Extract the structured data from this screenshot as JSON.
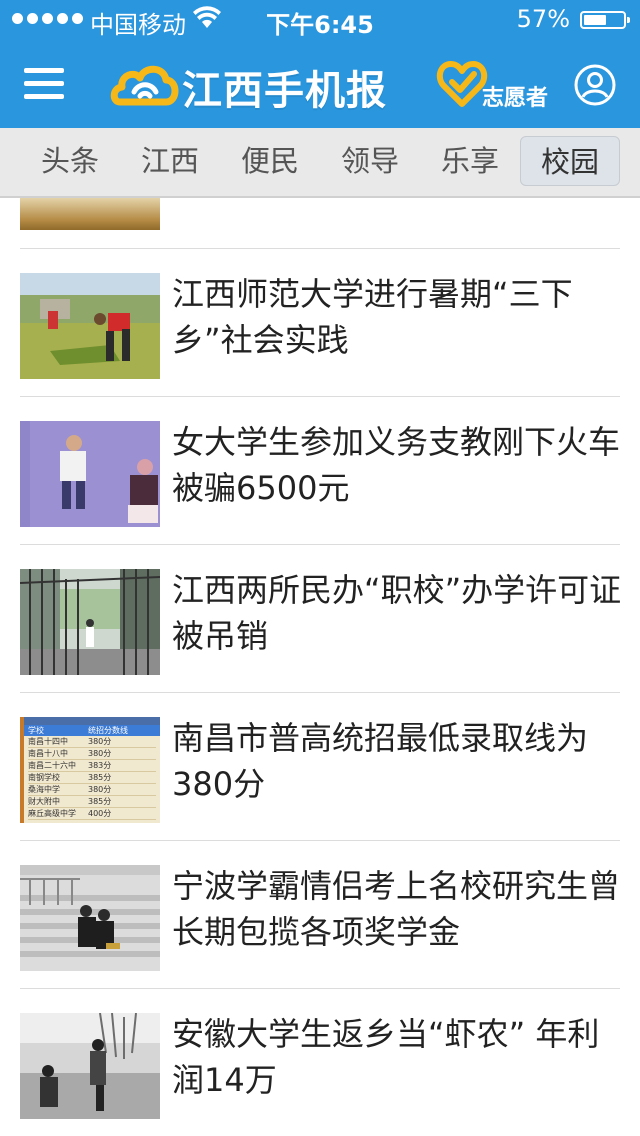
{
  "status_bar": {
    "carrier": "中国移动",
    "time": "下午6:45",
    "battery_text": "57%",
    "battery_level": 0.57
  },
  "header": {
    "app_title": "江西手机报",
    "volunteer_label": "志愿者",
    "icons": [
      "menu-icon",
      "logo-icon",
      "volunteer-heart-icon",
      "user-icon"
    ]
  },
  "tabs": [
    {
      "label": "头条"
    },
    {
      "label": "江西"
    },
    {
      "label": "便民"
    },
    {
      "label": "领导"
    },
    {
      "label": "乐享"
    },
    {
      "label": "校园",
      "active": true
    }
  ],
  "news": [
    {
      "title": "江西师范大学进行暑期“三下乡”社会实践"
    },
    {
      "title": "女大学生参加义务支教刚下火车被骗6500元"
    },
    {
      "title": "江西两所民办“职校”办学许可证被吊销"
    },
    {
      "title": "南昌市普高统招最低录取线为380分"
    },
    {
      "title": "宁波学霸情侣考上名校研究生曾长期包揽各项奖学金"
    },
    {
      "title": "安徽大学生返乡当“虾农” 年利润14万"
    }
  ],
  "score_table": {
    "header": [
      "学校",
      "统招分数线"
    ],
    "rows": [
      [
        "南昌十四中",
        "380分"
      ],
      [
        "南昌十八中",
        "380分"
      ],
      [
        "南昌二十六中",
        "383分"
      ],
      [
        "南钢学校",
        "385分"
      ],
      [
        "桑海中学",
        "380分"
      ],
      [
        "财大附中",
        "385分"
      ],
      [
        "麻丘高级中学",
        "400分"
      ]
    ]
  },
  "colors": {
    "brand_blue": "#2a96de",
    "logo_yellow": "#f5b818"
  }
}
